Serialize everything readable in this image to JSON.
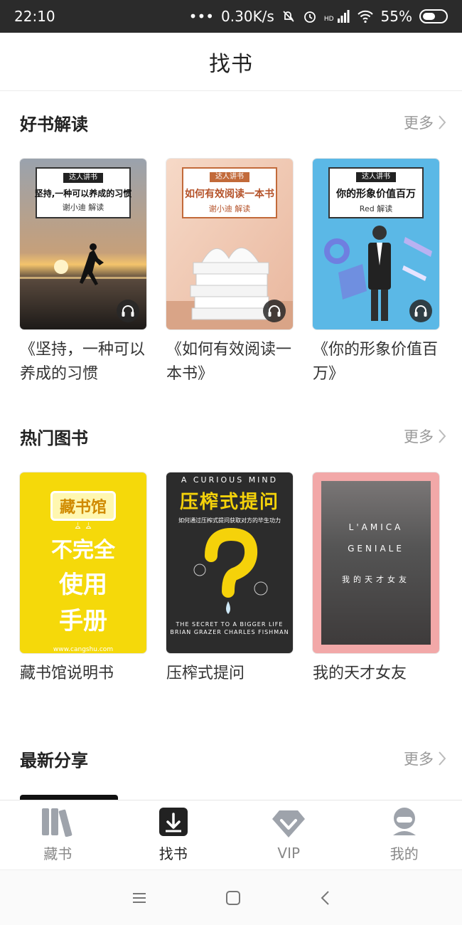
{
  "status": {
    "time": "22:10",
    "net_speed": "0.30K/s",
    "network_label": "HD",
    "battery": "55%",
    "battery_level": 0.55
  },
  "header": {
    "title": "找书"
  },
  "sections": {
    "good_reads": {
      "title": "好书解读",
      "more": "更多",
      "books": [
        {
          "title": "《坚持，一种可以养成的习惯",
          "badge_tag": "达人讲书",
          "badge_main": "坚持,一种可以养成的习惯",
          "badge_author": "谢小迪 解读"
        },
        {
          "title": "《如何有效阅读一本书》",
          "badge_tag": "达人讲书",
          "badge_main": "如何有效阅读一本书",
          "badge_author": "谢小迪 解读"
        },
        {
          "title": "《你的形象价值百万》",
          "badge_tag": "达人讲书",
          "badge_main": "你的形象价值百万",
          "badge_author": "Red 解读"
        }
      ]
    },
    "hot_books": {
      "title": "热门图书",
      "more": "更多",
      "books": [
        {
          "title": "藏书馆说明书",
          "cover_logo": "藏书馆",
          "cover_text": [
            "不完全",
            "使用",
            "手册"
          ],
          "cover_url": "www.cangshu.com"
        },
        {
          "title": "压榨式提问",
          "cover_top": "A CURIOUS MIND",
          "cover_title": "压榨式提问",
          "cover_sub": "如何通过压榨式提问获取对方的毕生功力",
          "cover_foot1": "THE SECRET TO A BIGGER LIFE",
          "cover_foot2": "BRIAN GRAZER  CHARLES FISHMAN"
        },
        {
          "title": "我的天才女友",
          "cover_en1": "L'AMICA",
          "cover_en2": "GENIALE",
          "cover_cn": "我的天才女友"
        }
      ]
    },
    "latest": {
      "title": "最新分享",
      "more": "更多"
    }
  },
  "tabbar": {
    "tabs": [
      {
        "label": "藏书",
        "icon": "bookshelf-icon",
        "active": false
      },
      {
        "label": "找书",
        "icon": "find-book-icon",
        "active": true
      },
      {
        "label": "VIP",
        "icon": "diamond-icon",
        "active": false
      },
      {
        "label": "我的",
        "icon": "profile-icon",
        "active": false
      }
    ]
  },
  "colors": {
    "accent": "#222222",
    "muted": "#999999",
    "status_bar": "#2b2b2b",
    "cover_yellow": "#f5d90a",
    "cover_blue": "#5bb8e6",
    "cover_pink": "#f2a8a8"
  }
}
